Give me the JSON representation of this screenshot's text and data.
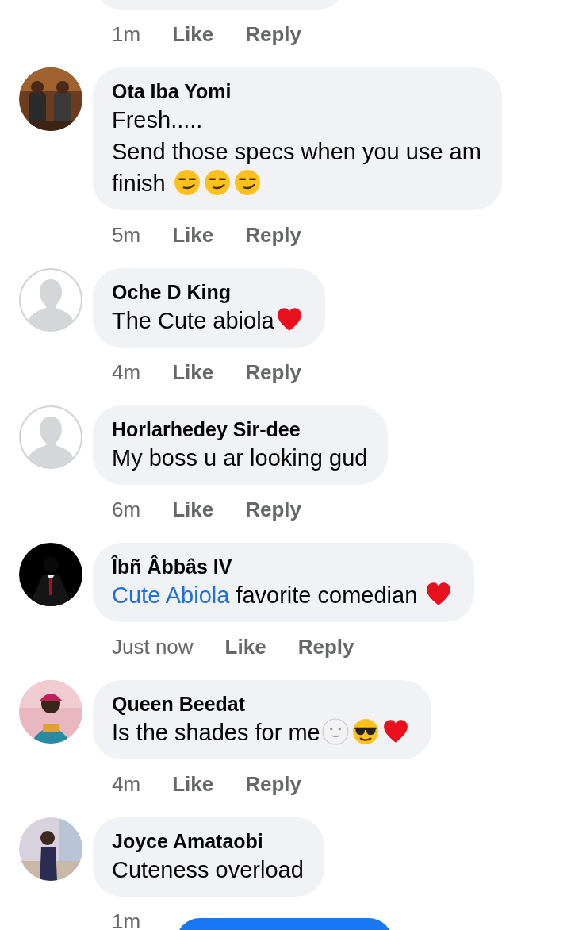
{
  "top_comment": {
    "time": "1m",
    "like": "Like",
    "reply": "Reply"
  },
  "comments": [
    {
      "avatar": {
        "kind": "picture"
      },
      "name": "Ota Iba Yomi",
      "lines": [
        [
          {
            "kind": "text",
            "text": "Fresh....."
          }
        ],
        [
          {
            "kind": "text",
            "text": "Send those specs when you use am"
          }
        ],
        [
          {
            "kind": "text",
            "text": "finish "
          },
          {
            "kind": "smirk"
          },
          {
            "kind": "smirk"
          },
          {
            "kind": "smirk"
          }
        ]
      ],
      "time": "5m",
      "like": "Like",
      "reply": "Reply"
    },
    {
      "avatar": {
        "kind": "silhouette"
      },
      "name": "Oche D King",
      "lines": [
        [
          {
            "kind": "text",
            "text": "The Cute abiola"
          },
          {
            "kind": "heart"
          }
        ]
      ],
      "time": "4m",
      "like": "Like",
      "reply": "Reply"
    },
    {
      "avatar": {
        "kind": "silhouette"
      },
      "name": "Horlarhedey Sir-dee",
      "lines": [
        [
          {
            "kind": "text",
            "text": "My boss u ar looking gud"
          }
        ]
      ],
      "time": "6m",
      "like": "Like",
      "reply": "Reply"
    },
    {
      "avatar": {
        "kind": "picture"
      },
      "name": "Îbñ Âbbâs IV",
      "lines": [
        [
          {
            "kind": "mention",
            "text": "Cute Abiola"
          },
          {
            "kind": "text",
            "text": " favorite comedian "
          },
          {
            "kind": "heart"
          }
        ]
      ],
      "time": "Just now",
      "like": "Like",
      "reply": "Reply"
    },
    {
      "avatar": {
        "kind": "picture"
      },
      "name": "Queen Beedat",
      "lines": [
        [
          {
            "kind": "text",
            "text": "Is the shades for me"
          },
          {
            "kind": "moon"
          },
          {
            "kind": "sunglasses"
          },
          {
            "kind": "heart"
          }
        ]
      ],
      "time": "4m",
      "like": "Like",
      "reply": "Reply"
    },
    {
      "avatar": {
        "kind": "picture"
      },
      "name": "Joyce Amataobi",
      "lines": [
        [
          {
            "kind": "text",
            "text": "Cuteness overload"
          }
        ]
      ],
      "time": "1m"
    }
  ],
  "floating_button": {
    "kind": "pill"
  }
}
